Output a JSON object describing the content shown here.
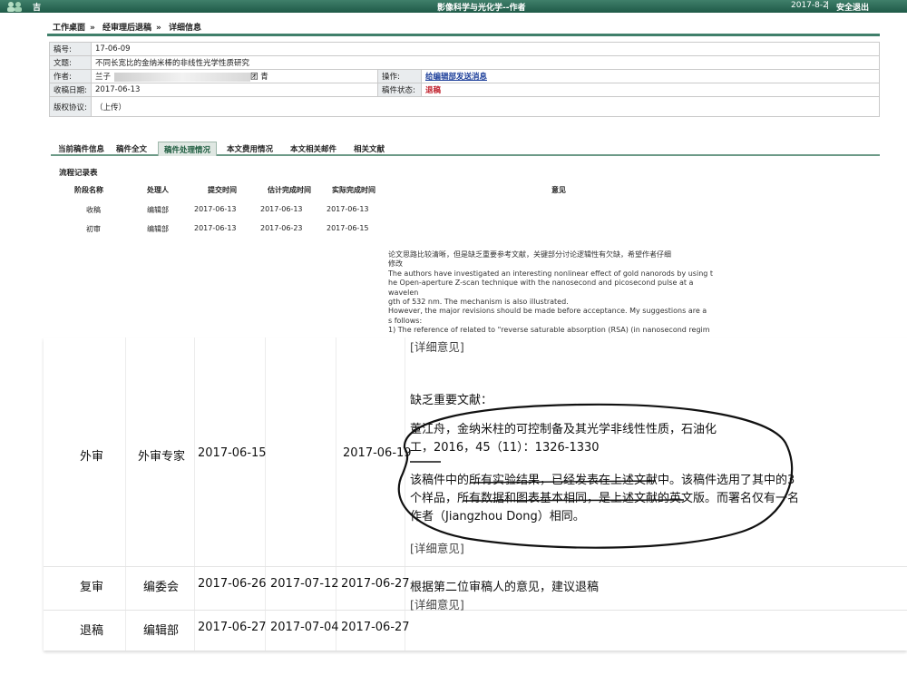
{
  "topbar": {
    "logo_text": "吉",
    "app_title": "影像科学与光化学--作者",
    "date": "2017-8-2",
    "separator": "|",
    "logout": "安全退出",
    "brand_color": "#2c6a55"
  },
  "breadcrumb": [
    "工作桌面",
    "经审理后退稿",
    "详细信息"
  ],
  "info": {
    "id_label": "稿号:",
    "id_value": "17-06-09",
    "title_label": "文题:",
    "title_value": "不同长宽比的金纳米棒的非线性光学性质研究",
    "author_label": "作者:",
    "author_value": "兰子",
    "author_tail": "团 青",
    "operation_label": "操作:",
    "operation_value": "给编辑部发送消息",
    "received_label": "收稿日期:",
    "received_value": "2017-06-13",
    "status_label": "稿件状态:",
    "status_value": "退稿",
    "copyright_label": "版权协议:",
    "copyright_value": "（上传）"
  },
  "tabs": [
    {
      "label": "当前稿件信息",
      "active": false
    },
    {
      "label": "稿件全文",
      "active": false
    },
    {
      "label": "稿件处理情况",
      "active": true
    },
    {
      "label": "本文费用情况",
      "active": false
    },
    {
      "label": "本文相关邮件",
      "active": false
    },
    {
      "label": "相关文献",
      "active": false
    }
  ],
  "flow": {
    "title": "流程记录表",
    "headers": [
      "阶段名称",
      "处理人",
      "提交时间",
      "估计完成时间",
      "实际完成时间",
      "意见"
    ],
    "rows_small": [
      {
        "stage": "收稿",
        "handler": "编辑部",
        "submitted": "2017-06-13",
        "estimated": "2017-06-13",
        "actual": "2017-06-13"
      },
      {
        "stage": "初审",
        "handler": "编辑部",
        "submitted": "2017-06-13",
        "estimated": "2017-06-23",
        "actual": "2017-06-15"
      }
    ],
    "first_opinion": [
      "论文思路比较清晰，但是缺乏重要参考文献，关键部分讨论逻辑性有欠缺，希望作者仔细",
      "修改",
      "The authors have investigated an interesting nonlinear effect of gold nanorods by using t",
      "he Open-aperture Z-scan technique with the nanosecond and picosecond pulse at a wavelen",
      "gth of 532 nm. The mechanism is also illustrated.",
      "However, the major revisions should be made before acceptance. My suggestions are a",
      "s follows:",
      "1) The reference of related to \"reverse saturable absorption (RSA) (in nanosecond regim"
    ],
    "detail_link": "[详细意见]",
    "rows_large": [
      {
        "stage": "外审",
        "handler": "外审专家",
        "submitted": "2017-06-15",
        "estimated": "",
        "actual": "2017-06-19",
        "opinion": [
          "缺乏重要文献：",
          "董江舟，金纳米柱的可控制备及其光学非线性性质，石油化",
          "工，2016，45（11）：1326-1330",
          "该稿件中的所有实验结果，已经发表在上述文献中。该稿件选用了其中的3",
          "个样品，所有数据和图表基本相同，是上述文献的英文版。而署名仅有一名",
          "作者（Jiangzhou Dong）相同。"
        ],
        "link": "[详细意见]"
      },
      {
        "stage": "复审",
        "handler": "编委会",
        "submitted": "2017-06-26",
        "estimated": "2017-07-12",
        "actual": "2017-06-27",
        "opinion": [
          "根据第二位审稿人的意见，建议退稿"
        ],
        "link": "[详细意见]"
      },
      {
        "stage": "退稿",
        "handler": "编辑部",
        "submitted": "2017-06-27",
        "estimated": "2017-07-04",
        "actual": "2017-06-27",
        "opinion": [],
        "link": ""
      }
    ]
  }
}
